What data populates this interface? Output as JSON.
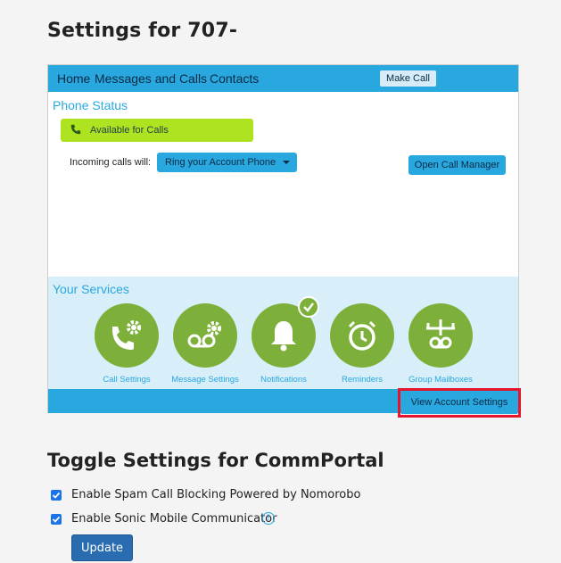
{
  "page": {
    "title": "Settings for 707-",
    "toggle_title": "Toggle Settings for CommPortal"
  },
  "portal": {
    "nav": [
      "Home",
      "Messages and Calls",
      "Contacts"
    ],
    "make_call": "Make Call",
    "phone_status_title": "Phone Status",
    "available": "Available for Calls",
    "incoming_label": "Incoming calls will:",
    "ring_select": "Ring your Account Phone",
    "open_call_manager": "Open Call Manager",
    "services_title": "Your Services",
    "services": [
      {
        "label": "Call Settings",
        "icon": "phone-gear-icon"
      },
      {
        "label": "Message Settings",
        "icon": "voicemail-gear-icon"
      },
      {
        "label": "Notifications",
        "icon": "bell-icon"
      },
      {
        "label": "Reminders",
        "icon": "alarm-clock-icon"
      },
      {
        "label": "Group Mailboxes",
        "icon": "group-mailbox-icon"
      }
    ],
    "view_account_settings": "View Account Settings"
  },
  "toggles": [
    {
      "label": "Enable Spam Call Blocking Powered by Nomorobo",
      "checked": true
    },
    {
      "label": "Enable Sonic Mobile Communicator",
      "checked": true
    }
  ],
  "help_glyph": "?",
  "update_button": "Update",
  "colors": {
    "accent": "#29a8e0",
    "service_green": "#7cb03a",
    "available_green": "#aee321",
    "highlight_red": "#e3162e",
    "update_blue": "#2a6cb0"
  }
}
